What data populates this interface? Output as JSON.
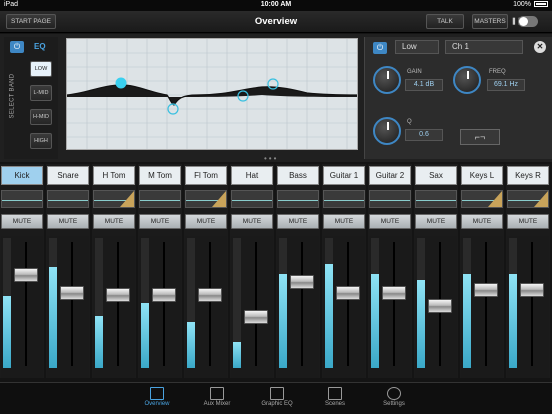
{
  "status": {
    "device": "iPad",
    "time": "10:00 AM",
    "battery": "100%"
  },
  "header": {
    "title": "Overview",
    "start_page": "START PAGE",
    "talk": "TALK",
    "masters": "MASTERS"
  },
  "eq": {
    "label": "EQ",
    "select_band": "SELECT BAND",
    "bands": [
      "LOW",
      "L-MID",
      "H-MID",
      "HIGH"
    ],
    "active_band": "LOW",
    "band_field": "Low",
    "channel_field": "Ch 1",
    "gain_label": "GAIN",
    "gain_value": "4.1 dB",
    "freq_label": "FREQ",
    "freq_value": "69.1 Hz",
    "q_label": "Q",
    "q_value": "0.6",
    "accent": "#3e87c4"
  },
  "channels": [
    {
      "name": "Kick",
      "mute": "MUTE",
      "selected": true,
      "meter_level": 0.55,
      "fader_level": 0.78
    },
    {
      "name": "Snare",
      "mute": "MUTE",
      "selected": false,
      "meter_level": 0.78,
      "fader_level": 0.62
    },
    {
      "name": "H Tom",
      "mute": "MUTE",
      "selected": false,
      "meter_level": 0.4,
      "fader_level": 0.6
    },
    {
      "name": "M Tom",
      "mute": "MUTE",
      "selected": false,
      "meter_level": 0.5,
      "fader_level": 0.6
    },
    {
      "name": "Fl Tom",
      "mute": "MUTE",
      "selected": false,
      "meter_level": 0.35,
      "fader_level": 0.6
    },
    {
      "name": "Hat",
      "mute": "MUTE",
      "selected": false,
      "meter_level": 0.2,
      "fader_level": 0.4
    },
    {
      "name": "Bass",
      "mute": "MUTE",
      "selected": false,
      "meter_level": 0.72,
      "fader_level": 0.72
    },
    {
      "name": "Guitar 1",
      "mute": "MUTE",
      "selected": false,
      "meter_level": 0.8,
      "fader_level": 0.62
    },
    {
      "name": "Guitar 2",
      "mute": "MUTE",
      "selected": false,
      "meter_level": 0.72,
      "fader_level": 0.62
    },
    {
      "name": "Sax",
      "mute": "MUTE",
      "selected": false,
      "meter_level": 0.68,
      "fader_level": 0.5
    },
    {
      "name": "Keys L",
      "mute": "MUTE",
      "selected": false,
      "meter_level": 0.72,
      "fader_level": 0.65
    },
    {
      "name": "Keys R",
      "mute": "MUTE",
      "selected": false,
      "meter_level": 0.72,
      "fader_level": 0.65
    }
  ],
  "tabs": [
    {
      "label": "Overview",
      "icon": "overview-icon",
      "active": true
    },
    {
      "label": "Aux Mixer",
      "icon": "aux-mixer-icon",
      "active": false
    },
    {
      "label": "Graphic EQ",
      "icon": "graphic-eq-icon",
      "active": false
    },
    {
      "label": "Scenes",
      "icon": "scenes-icon",
      "active": false
    },
    {
      "label": "Settings",
      "icon": "gear-icon",
      "active": false
    }
  ]
}
